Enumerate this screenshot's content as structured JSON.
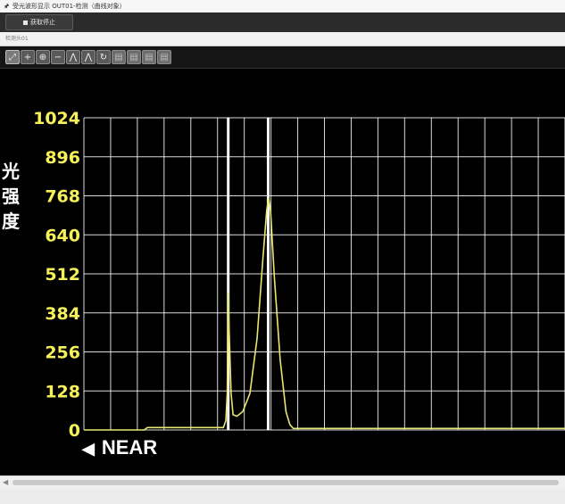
{
  "window": {
    "title": "受光波形显示 OUT01-检测（曲线对象）",
    "pin_icon": "pin-icon"
  },
  "toolbar": {
    "stop_label": "获取停止",
    "stop_icon": "stop-square-icon"
  },
  "header": {
    "label": "检测头01"
  },
  "chart_tools": [
    {
      "name": "zoom-fit-icon",
      "glyph": "⤢",
      "active": true
    },
    {
      "name": "zoom-in-icon",
      "glyph": "+",
      "active": false
    },
    {
      "name": "zoom-in-x-icon",
      "glyph": "⊕",
      "active": false
    },
    {
      "name": "zoom-out-icon",
      "glyph": "−",
      "active": false
    },
    {
      "name": "peak-marker-icon",
      "glyph": "⋀",
      "active": false
    },
    {
      "name": "peak-select-icon",
      "glyph": "⋀",
      "active": false
    },
    {
      "name": "refresh-icon",
      "glyph": "↻",
      "active": false
    },
    {
      "name": "export-icon-1",
      "glyph": "▤",
      "active": false
    },
    {
      "name": "export-icon-2",
      "glyph": "▤",
      "active": false
    },
    {
      "name": "export-icon-3",
      "glyph": "▤",
      "active": false
    },
    {
      "name": "export-icon-4",
      "glyph": "▤",
      "active": false
    }
  ],
  "chart_data": {
    "type": "line",
    "ylabel": "光强度",
    "yticks": [
      "1024",
      "896",
      "768",
      "640",
      "512",
      "384",
      "256",
      "128",
      "0"
    ],
    "ylim": [
      0,
      1024
    ],
    "xlim": [
      0,
      1
    ],
    "grid": true,
    "direction_label": "NEAR",
    "colors": {
      "background": "#000000",
      "grid": "#ffffff",
      "line": "#e8e870",
      "tick_label": "#f7f25a",
      "marker": "#ffffff"
    },
    "markers_x": [
      0.3,
      0.383
    ],
    "series": [
      {
        "points": [
          [
            0.0,
            0
          ],
          [
            0.125,
            0
          ],
          [
            0.132,
            8
          ],
          [
            0.29,
            8
          ],
          [
            0.295,
            30
          ],
          [
            0.298,
            120
          ],
          [
            0.3,
            450
          ],
          [
            0.302,
            320
          ],
          [
            0.306,
            120
          ],
          [
            0.31,
            50
          ],
          [
            0.318,
            45
          ],
          [
            0.33,
            60
          ],
          [
            0.345,
            120
          ],
          [
            0.36,
            300
          ],
          [
            0.372,
            560
          ],
          [
            0.38,
            720
          ],
          [
            0.384,
            762
          ],
          [
            0.388,
            720
          ],
          [
            0.396,
            500
          ],
          [
            0.408,
            230
          ],
          [
            0.42,
            60
          ],
          [
            0.428,
            18
          ],
          [
            0.435,
            5
          ],
          [
            1.0,
            5
          ]
        ]
      }
    ]
  },
  "scrollbar": {
    "left_arrow_icon": "scroll-left-arrow-icon"
  }
}
